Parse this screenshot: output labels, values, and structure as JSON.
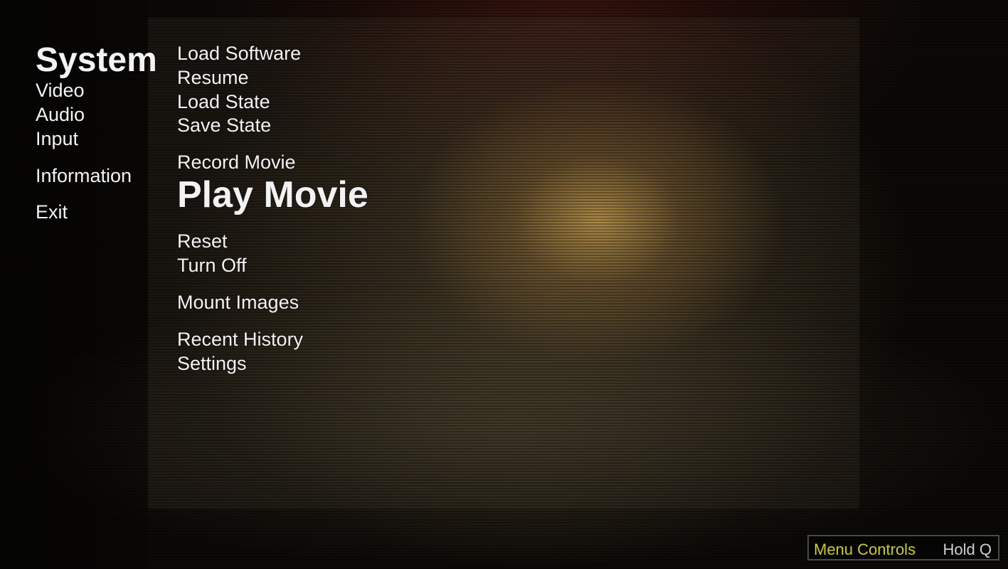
{
  "categories": [
    {
      "label": "System",
      "selected": true
    },
    {
      "label": "Video"
    },
    {
      "label": "Audio"
    },
    {
      "label": "Input"
    },
    {
      "label": "Information"
    },
    {
      "label": "Exit"
    }
  ],
  "system_menu": [
    {
      "label": "Load Software"
    },
    {
      "label": "Resume"
    },
    {
      "label": "Load State"
    },
    {
      "label": "Save State"
    },
    {
      "label": "Record Movie"
    },
    {
      "label": "Play Movie",
      "selected": true
    },
    {
      "label": "Reset"
    },
    {
      "label": "Turn Off"
    },
    {
      "label": "Mount Images"
    },
    {
      "label": "Recent History"
    },
    {
      "label": "Settings"
    }
  ],
  "hint": {
    "label": "Menu Controls",
    "key": "Hold Q"
  },
  "colors": {
    "hint_label": "#c9c93a",
    "text": "#f2f2f2"
  }
}
